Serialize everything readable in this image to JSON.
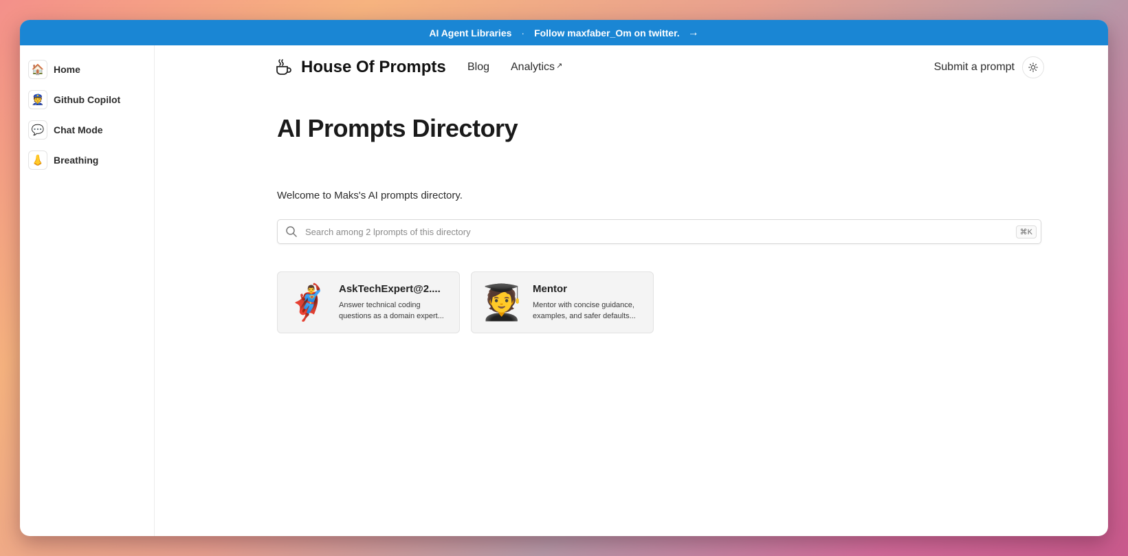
{
  "banner": {
    "left_text": "AI Agent Libraries",
    "separator": "·",
    "right_text": "Follow maxfaber_Om on twitter.",
    "arrow": "→"
  },
  "sidebar": {
    "items": [
      {
        "label": "Home",
        "icon": "🏠",
        "icon_name": "house-icon"
      },
      {
        "label": "Github Copilot",
        "icon": "👮",
        "icon_name": "pilot-icon"
      },
      {
        "label": "Chat Mode",
        "icon": "💬",
        "icon_name": "speech-bubble-icon"
      },
      {
        "label": "Breathing",
        "icon": "👃",
        "icon_name": "nose-icon"
      }
    ]
  },
  "header": {
    "brand": "House Of Prompts",
    "brand_icon": "coffee-cup-icon",
    "nav": {
      "blog": "Blog",
      "analytics": "Analytics",
      "analytics_ext": "↗"
    },
    "submit": "Submit a prompt",
    "theme_icon": "sun-icon"
  },
  "main": {
    "title": "AI Prompts Directory",
    "welcome": "Welcome to Maks's AI prompts directory.",
    "search": {
      "placeholder": "Search among 2 lprompts of this directory",
      "shortcut": "⌘K"
    },
    "cards": [
      {
        "emoji": "🦸‍♂️",
        "title": "AskTechExpert@2....",
        "desc": "Answer technical coding questions as a domain expert..."
      },
      {
        "emoji": "🧑‍🎓",
        "title": "Mentor",
        "desc": "Mentor with concise guidance, examples, and safer defaults..."
      }
    ]
  },
  "colors": {
    "banner": "#1a86d4",
    "card_bg": "#f4f4f4"
  }
}
